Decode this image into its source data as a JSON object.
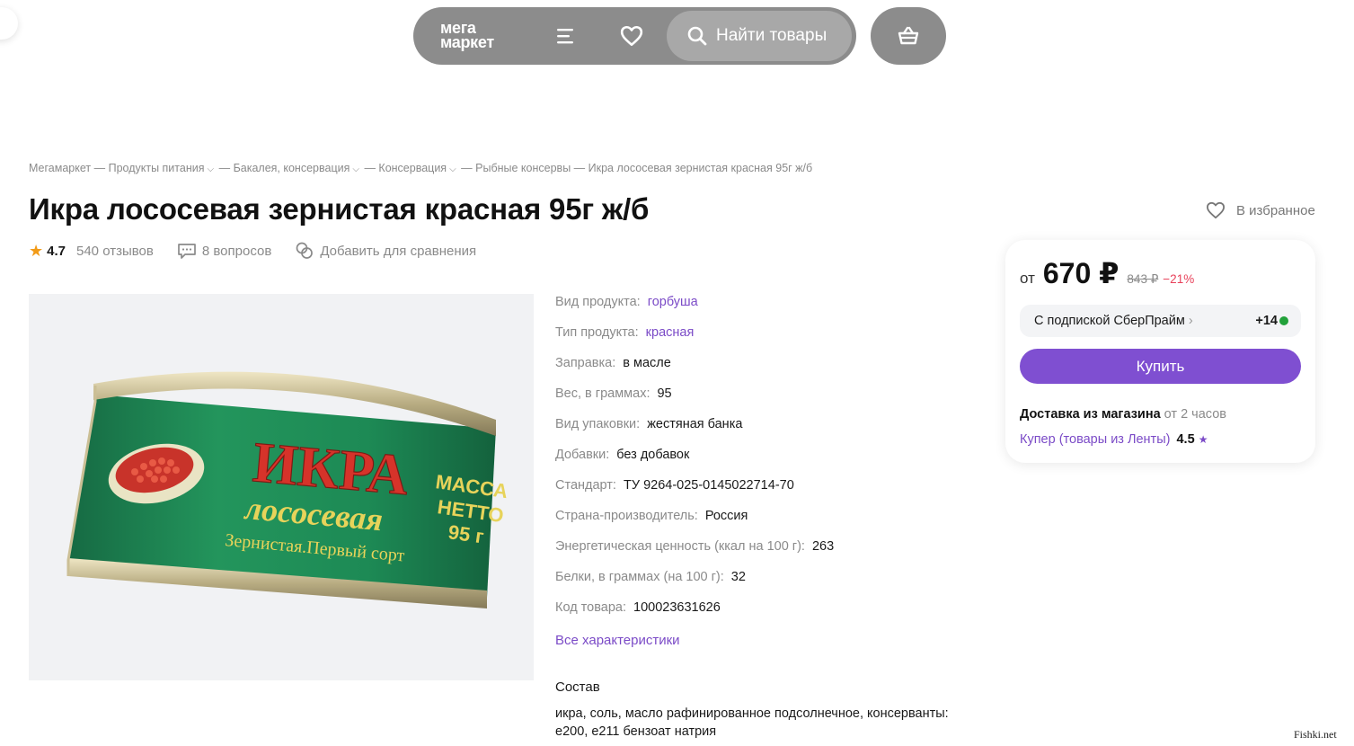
{
  "nav": {
    "logo_line1": "мега",
    "logo_line2": "маркет",
    "search_label": "Найти товары"
  },
  "breadcrumb": {
    "items": [
      "Мегамаркет",
      "Продукты питания",
      "Бакалея, консервация",
      "Консервация",
      "Рыбные консервы",
      "Икра лососевая зернистая красная 95г ж/б"
    ],
    "separator": "—"
  },
  "product": {
    "title": "Икра лососевая зернистая красная 95г ж/б",
    "favorite_label": "В избранное",
    "rating": "4.7",
    "reviews": "540 отзывов",
    "questions": "8 вопросов",
    "compare": "Добавить для сравнения"
  },
  "can_label": {
    "word1": "ИКРА",
    "word2": "лососевая",
    "word3": "Зернистая.Первый сорт",
    "mass1": "МАССА",
    "mass2": "НЕТТО",
    "mass3": "95 г"
  },
  "specs": [
    {
      "label": "Вид продукта:",
      "value": "горбуша",
      "link": true
    },
    {
      "label": "Тип продукта:",
      "value": "красная",
      "link": true
    },
    {
      "label": "Заправка:",
      "value": "в масле",
      "link": false
    },
    {
      "label": "Вес, в граммах:",
      "value": "95",
      "link": false
    },
    {
      "label": "Вид упаковки:",
      "value": "жестяная банка",
      "link": false
    },
    {
      "label": "Добавки:",
      "value": "без добавок",
      "link": false
    },
    {
      "label": "Стандарт:",
      "value": "ТУ 9264-025-0145022714-70",
      "link": false
    },
    {
      "label": "Страна-производитель:",
      "value": "Россия",
      "link": false
    },
    {
      "label": "Энергетическая ценность (ккал на 100 г):",
      "value": "263",
      "link": false
    },
    {
      "label": "Белки, в граммах (на 100 г):",
      "value": "32",
      "link": false
    },
    {
      "label": "Код товара:",
      "value": "100023631626",
      "link": false
    }
  ],
  "all_specs_label": "Все характеристики",
  "composition": {
    "title": "Состав",
    "text": "икра, соль, масло рафинированное подсолнечное, консерванты: е200, е211 бензоат натрия"
  },
  "price_card": {
    "from": "от",
    "price": "670 ₽",
    "old_price": "843 ₽",
    "discount": "−21%",
    "sber_label": "С подпиской СберПрайм",
    "sber_bonus": "+14",
    "buy_label": "Купить",
    "delivery_bold": "Доставка из магазина",
    "delivery_time": "от 2 часов",
    "seller": "Купер (товары из Ленты)",
    "seller_rating": "4.5"
  },
  "watermark": "Fishki.net",
  "colors": {
    "accent": "#7f4fd1",
    "link": "#7b4bc7",
    "discount": "#e8415a",
    "star": "#f29b18",
    "nav_bg": "#8c8c8c",
    "can_green": "#1f8a55"
  }
}
